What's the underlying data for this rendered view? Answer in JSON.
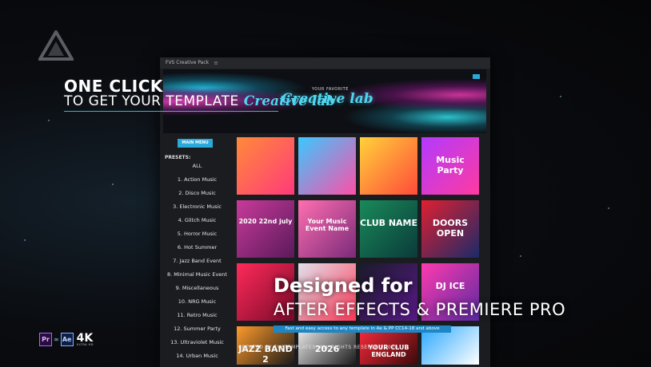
{
  "window": {
    "title": "FVS Creative Pack",
    "menu_icon": "menu-icon"
  },
  "banner": {
    "tagline": "YOUR FAVORITE",
    "brand": "Creative lab"
  },
  "headline": {
    "line1": "ONE CLICK",
    "line2": "TO GET YOUR TEMPLATE",
    "script": "Creative lab"
  },
  "sidebar": {
    "main_menu_label": "MAIN MENU",
    "presets_label": "PRESETS:",
    "items": [
      "ALL",
      "1. Action Music",
      "2. Disco Music",
      "3. Electronic Music",
      "4. Glitch Music",
      "5. Horror Music",
      "6. Hot Summer",
      "7. Jazz Band Event",
      "8. Minimal Music Event",
      "9. Miscellaneous",
      "10. NRG Music",
      "11. Retro Music",
      "12. Summer Party",
      "13. Ultraviolet Music",
      "14. Urban Music"
    ]
  },
  "tiles": [
    {
      "text": "",
      "colors": [
        "#ff8a3a",
        "#ff3a7a"
      ]
    },
    {
      "text": "",
      "colors": [
        "#3ac8ff",
        "#ff4fa8"
      ]
    },
    {
      "text": "",
      "colors": [
        "#ffd23a",
        "#ff4a3a"
      ]
    },
    {
      "text": "Music Party",
      "colors": [
        "#b23aff",
        "#ff3aa0"
      ]
    },
    {
      "text": "2020 22nd july",
      "colors": [
        "#c83a9a",
        "#5a1a5a"
      ]
    },
    {
      "text": "Your Music Event Name",
      "colors": [
        "#ff6fb0",
        "#7a2a7a"
      ]
    },
    {
      "text": "CLUB NAME",
      "colors": [
        "#1a8a5a",
        "#0a3a3a"
      ]
    },
    {
      "text": "DOORS OPEN",
      "colors": [
        "#e02030",
        "#1a2a6a"
      ]
    },
    {
      "text": "",
      "colors": [
        "#ff2a5a",
        "#7a0a2a"
      ]
    },
    {
      "text": "",
      "colors": [
        "#e0e0ea",
        "#ff3a5a"
      ]
    },
    {
      "text": "",
      "colors": [
        "#1a1a2a",
        "#5a1a8a"
      ]
    },
    {
      "text": "DJ ICE",
      "colors": [
        "#ff3ab0",
        "#5a2aa0"
      ]
    },
    {
      "text": "JAZZ BAND 2",
      "colors": [
        "#ff9a2a",
        "#1a1a1a"
      ]
    },
    {
      "text": "2026",
      "colors": [
        "#f0f0f0",
        "#1a1a1a"
      ]
    },
    {
      "text": "YOUR CLUB ENGLAND",
      "colors": [
        "#ff2a3a",
        "#3a0a0a"
      ]
    },
    {
      "text": "",
      "colors": [
        "#2aa8ff",
        "#ffffff"
      ]
    }
  ],
  "designed": {
    "line1": "Designed for",
    "line2": "AFTER EFFECTS & PREMIERE PRO"
  },
  "access_bar": "Fast and easy access to any template in Ae & PP CC14-18 and above",
  "copyright": "CREATED BY FVSTEMPLATES. ALL RIGHTS RESERVED 2020.",
  "badges": {
    "pr": "Pr",
    "ae": "Ae",
    "k4": "4K",
    "uhd": "ULTRA HD"
  },
  "colors": {
    "accent": "#4fd6ef",
    "button": "#2aa9db",
    "background": "#08090c"
  }
}
